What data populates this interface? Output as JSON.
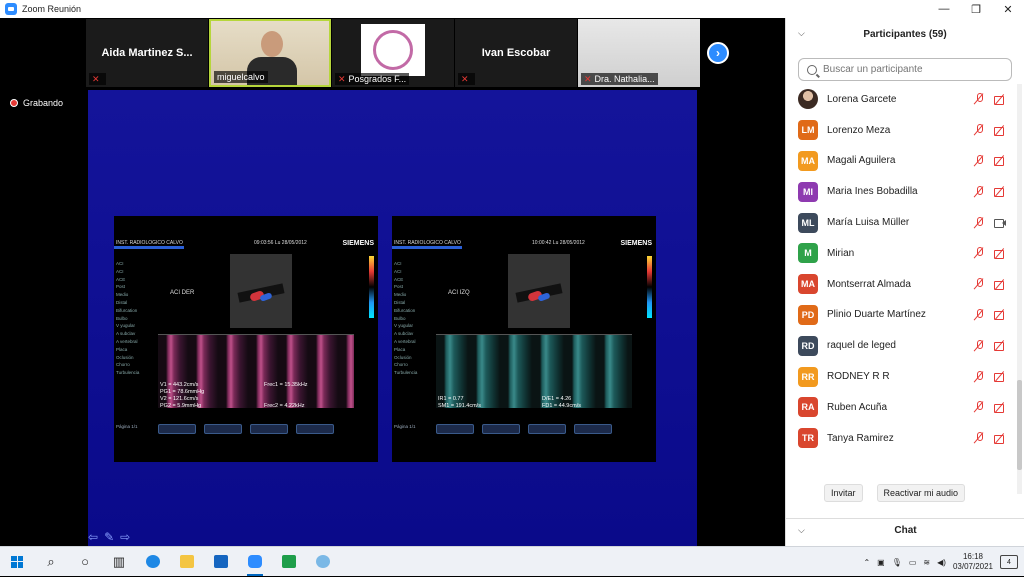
{
  "titlebar": {
    "title": "Zoom Reunión",
    "min": "—",
    "max": "❐",
    "close": "✕"
  },
  "strip": {
    "tiles": [
      {
        "name": "Aida Martinez S..."
      },
      {
        "caption": "miguelcalvo"
      },
      {
        "caption": "Posgrados F..."
      },
      {
        "name": "Ivan Escobar"
      },
      {
        "caption": "Dra. Nathalia..."
      }
    ]
  },
  "recording": "Grabando",
  "share": {
    "left": {
      "institution": "INST. RADIOLOGICO CALVO",
      "time": "09:03:56   Lu 28/05/2012",
      "brand": "SIEMENS",
      "label": "ACI DER",
      "menu": [
        "ACI",
        "ACI",
        "ACE",
        "Post",
        "Medio",
        "Distal",
        "Bifurcation",
        "Bulbo",
        "V yugular",
        "A subclav",
        "A vertebral",
        "Placa",
        "Oclusión",
        "Chorro",
        "Turbulencia"
      ],
      "readout_left": [
        "V1 = 443.2cm/s",
        "PG1 = 78.6mmHg",
        "V2 = 121.6cm/s",
        "PG2 = 5.9mmHg"
      ],
      "readout_right": [
        "Frec1 = 15.35kHz",
        "",
        "",
        "Frec2 = 4.22kHz"
      ],
      "footer": "Página 1/1"
    },
    "right": {
      "institution": "INST. RADIOLOGICO CALVO",
      "time": "10:00:42   Lu 28/05/2012",
      "brand": "SIEMENS",
      "label": "ACI IZQ",
      "menu": [
        "ACI",
        "ACI",
        "ACE",
        "Post",
        "Medio",
        "Distal",
        "Bifurcation",
        "Bulbo",
        "V yugular",
        "A subclav",
        "A vertebral",
        "Placa",
        "Oclusión",
        "Chorro",
        "Turbulencia"
      ],
      "readout_left": [
        "IR1 = 0.77",
        "SM1 = 191.4cm/s"
      ],
      "readout_right": [
        "D/E1 = 4.26",
        "FD1 = 44.9cm/s"
      ],
      "footer": "Página 1/1"
    }
  },
  "panel": {
    "title": "Participantes (59)",
    "search_placeholder": "Buscar un participante",
    "participants": [
      {
        "initials": "",
        "name": "Lorena Garcete",
        "color": "",
        "photo": true,
        "video": false
      },
      {
        "initials": "LM",
        "name": "Lorenzo Meza",
        "color": "#e06a18",
        "video": false
      },
      {
        "initials": "MA",
        "name": "Magali Aguilera",
        "color": "#f29a1f",
        "video": false
      },
      {
        "initials": "MI",
        "name": "Maria Ines Bobadilla",
        "color": "#8e3ab0",
        "video": false
      },
      {
        "initials": "ML",
        "name": "María Luisa Müller",
        "color": "#3d4a5c",
        "video": true
      },
      {
        "initials": "M",
        "name": "Mirian",
        "color": "#2fa24a",
        "video": false
      },
      {
        "initials": "MA",
        "name": "Montserrat Almada",
        "color": "#d9462e",
        "video": false
      },
      {
        "initials": "PD",
        "name": "Plinio Duarte Martínez",
        "color": "#e06a18",
        "video": false
      },
      {
        "initials": "RD",
        "name": "raquel de leged",
        "color": "#3d4a5c",
        "video": false
      },
      {
        "initials": "RR",
        "name": "RODNEY R R",
        "color": "#f29a1f",
        "video": false
      },
      {
        "initials": "RA",
        "name": "Ruben Acuña",
        "color": "#d9462e",
        "video": false
      },
      {
        "initials": "TR",
        "name": "Tanya Ramirez",
        "color": "#d9462e",
        "video": false
      }
    ],
    "invite": "Invitar",
    "unmute": "Reactivar mi audio",
    "chat": "Chat"
  },
  "taskbar": {
    "time": "16:18",
    "date": "03/07/2021",
    "notifications": "4"
  }
}
